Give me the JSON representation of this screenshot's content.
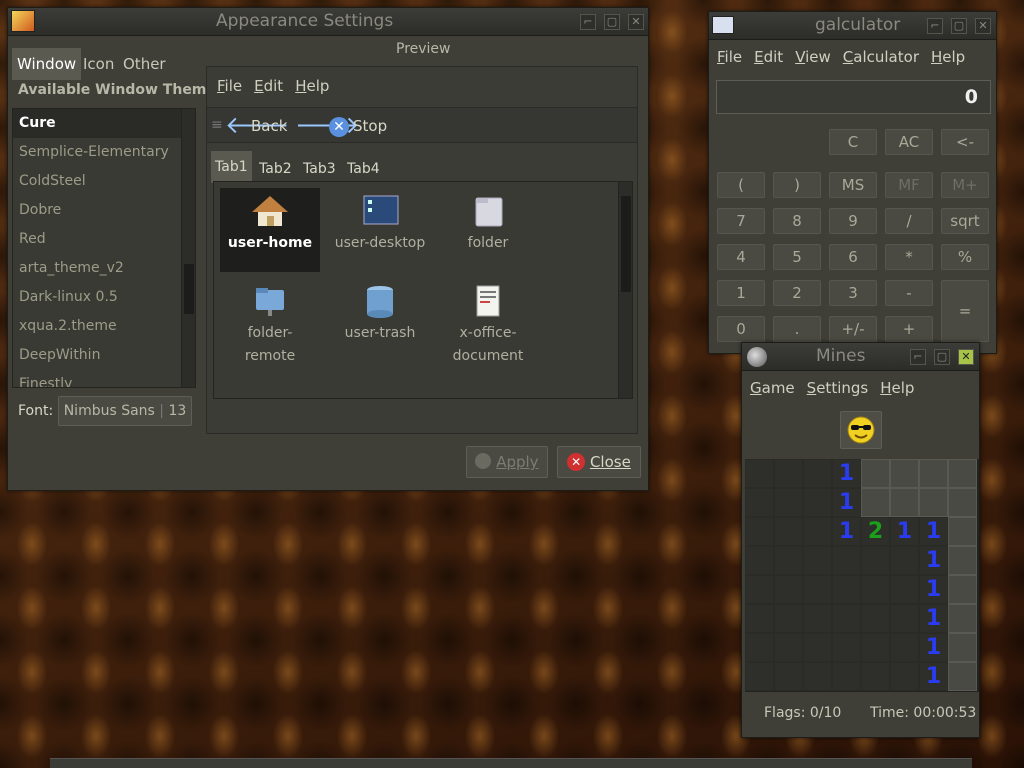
{
  "appearance": {
    "title": "Appearance Settings",
    "tabs": [
      "Window",
      "Icon",
      "Other"
    ],
    "themes_header": "Available Window Themes",
    "themes": [
      "Cure",
      "Semplice-Elementary",
      "ColdSteel",
      "Dobre",
      "Red",
      "arta_theme_v2",
      "Dark-linux 0.5",
      "xqua.2.theme",
      "DeepWithin",
      "Finestly"
    ],
    "font_label": "Font:",
    "font_name": "Nimbus Sans",
    "font_size": "13",
    "preview_label": "Preview",
    "preview_menu": [
      "File",
      "Edit",
      "Help"
    ],
    "toolbar": {
      "back": "Back",
      "stop": "Stop"
    },
    "preview_tabs": [
      "Tab1",
      "Tab2",
      "Tab3",
      "Tab4"
    ],
    "icons": [
      {
        "name": "home-icon",
        "label": "user-home"
      },
      {
        "name": "desktop-icon",
        "label": "user-desktop"
      },
      {
        "name": "folder-icon",
        "label": "folder"
      },
      {
        "name": "folder-remote-icon",
        "label": "folder-\nremote"
      },
      {
        "name": "trash-icon",
        "label": "user-trash"
      },
      {
        "name": "document-icon",
        "label": "x-office-\ndocument"
      }
    ],
    "apply_label": "Apply",
    "close_label": "Close"
  },
  "calculator": {
    "title": "galculator",
    "menu": [
      "File",
      "Edit",
      "View",
      "Calculator",
      "Help"
    ],
    "display": "0",
    "keys": [
      [
        "",
        "",
        "C",
        "AC",
        "<-"
      ],
      [
        "(",
        ")",
        "MS",
        "MF",
        "M+"
      ],
      [
        "7",
        "8",
        "9",
        "/",
        "sqrt"
      ],
      [
        "4",
        "5",
        "6",
        "*",
        "%"
      ],
      [
        "1",
        "2",
        "3",
        "-",
        "="
      ],
      [
        "0",
        ".",
        "+/-",
        "+",
        ""
      ]
    ]
  },
  "mines": {
    "title": "Mines",
    "menu": [
      "Game",
      "Settings",
      "Help"
    ],
    "board": [
      [
        "o",
        "o",
        "o",
        "1",
        "c",
        "c",
        "c",
        "c"
      ],
      [
        "o",
        "o",
        "o",
        "1",
        "c",
        "c",
        "c",
        "c"
      ],
      [
        "o",
        "o",
        "o",
        "1",
        "2",
        "1",
        "1",
        "c"
      ],
      [
        "o",
        "o",
        "o",
        "o",
        "o",
        "o",
        "1",
        "c"
      ],
      [
        "o",
        "o",
        "o",
        "o",
        "o",
        "o",
        "1",
        "c"
      ],
      [
        "o",
        "o",
        "o",
        "o",
        "o",
        "o",
        "1",
        "c"
      ],
      [
        "o",
        "o",
        "o",
        "o",
        "o",
        "o",
        "1",
        "c"
      ],
      [
        "o",
        "o",
        "o",
        "o",
        "o",
        "o",
        "1",
        "c"
      ]
    ],
    "flags": "Flags: 0/10",
    "time": "Time: 00:00:53"
  }
}
